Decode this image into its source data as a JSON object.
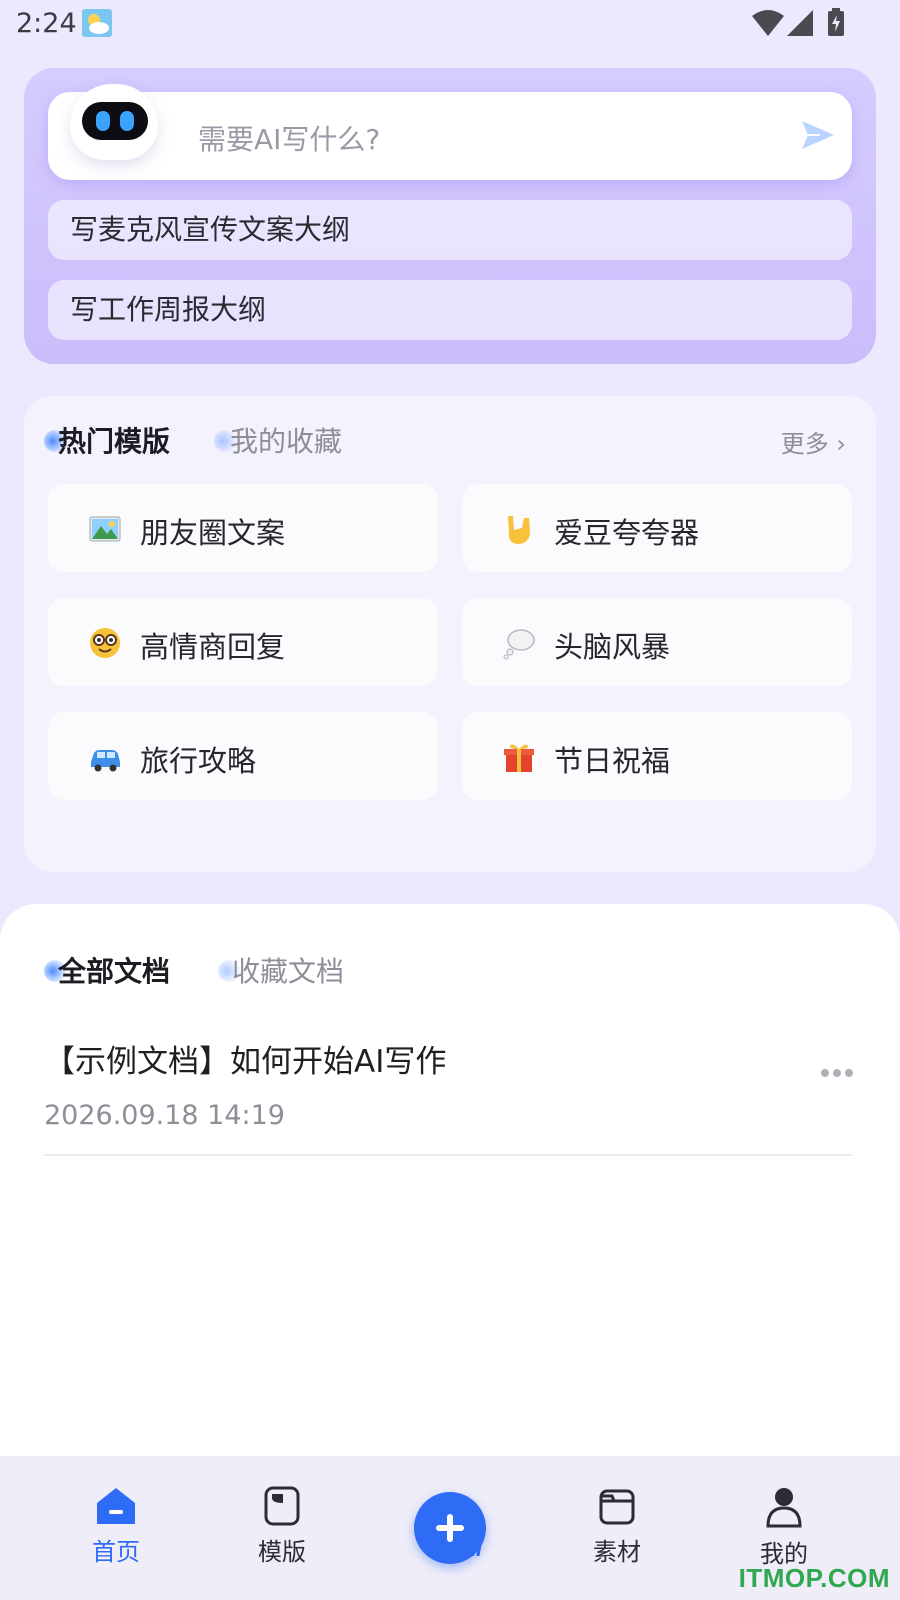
{
  "status_bar": {
    "time": "2:24"
  },
  "ai_prompt": {
    "placeholder": "需要AI写什么?",
    "suggestions": [
      "写麦克风宣传文案大纲",
      "写工作周报大纲"
    ]
  },
  "templates": {
    "tabs": [
      "热门模版",
      "我的收藏"
    ],
    "active_tab": "热门模版",
    "more_label": "更多",
    "items": [
      {
        "label": "朋友圈文案",
        "icon": "landscape-photo-icon"
      },
      {
        "label": "爱豆夸夸器",
        "icon": "rock-hand-icon"
      },
      {
        "label": "高情商回复",
        "icon": "nerd-face-icon"
      },
      {
        "label": "头脑风暴",
        "icon": "thought-bubble-icon"
      },
      {
        "label": "旅行攻略",
        "icon": "car-icon"
      },
      {
        "label": "节日祝福",
        "icon": "gift-icon"
      }
    ]
  },
  "documents": {
    "tabs": [
      "全部文档",
      "收藏文档"
    ],
    "active_tab": "全部文档",
    "items": [
      {
        "title": "【示例文档】如何开始AI写作",
        "time": "2026.09.18 14:19"
      }
    ]
  },
  "bottom_nav": {
    "items": [
      {
        "label": "首页",
        "icon": "home-icon",
        "active": true
      },
      {
        "label": "模版",
        "icon": "template-icon",
        "active": false
      },
      {
        "label": "",
        "icon": "ai-plus-icon",
        "active": false
      },
      {
        "label": "素材",
        "icon": "folder-icon",
        "active": false
      },
      {
        "label": "我的",
        "icon": "person-icon",
        "active": false
      }
    ],
    "ai_button_text": "AI"
  },
  "watermark": "ITMOP.COM",
  "colors": {
    "accent": "#2f6cf6",
    "background": "#ece8fd",
    "ai_card": "#cbbcfb"
  }
}
